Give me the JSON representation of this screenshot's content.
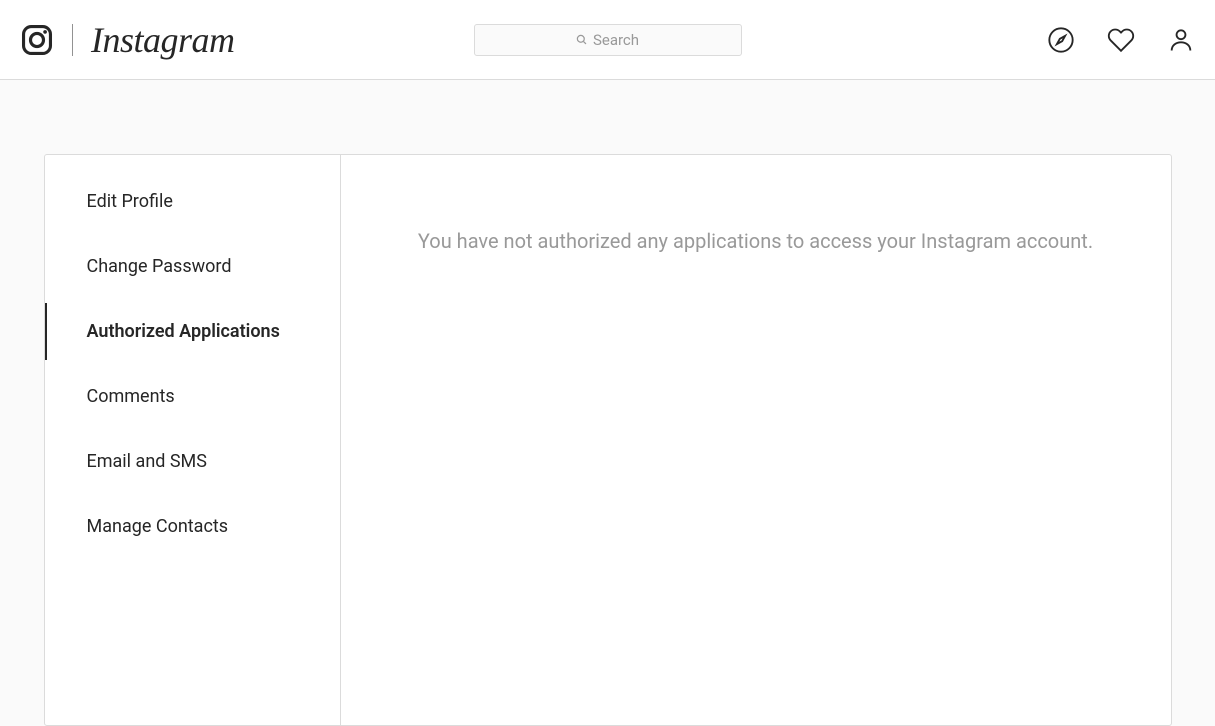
{
  "brand": {
    "name": "Instagram"
  },
  "search": {
    "placeholder": "Search"
  },
  "sidebar": {
    "items": [
      {
        "label": "Edit Profile",
        "active": false
      },
      {
        "label": "Change Password",
        "active": false
      },
      {
        "label": "Authorized Applications",
        "active": true
      },
      {
        "label": "Comments",
        "active": false
      },
      {
        "label": "Email and SMS",
        "active": false
      },
      {
        "label": "Manage Contacts",
        "active": false
      }
    ]
  },
  "main": {
    "empty_message": "You have not authorized any applications to access your Instagram account."
  }
}
